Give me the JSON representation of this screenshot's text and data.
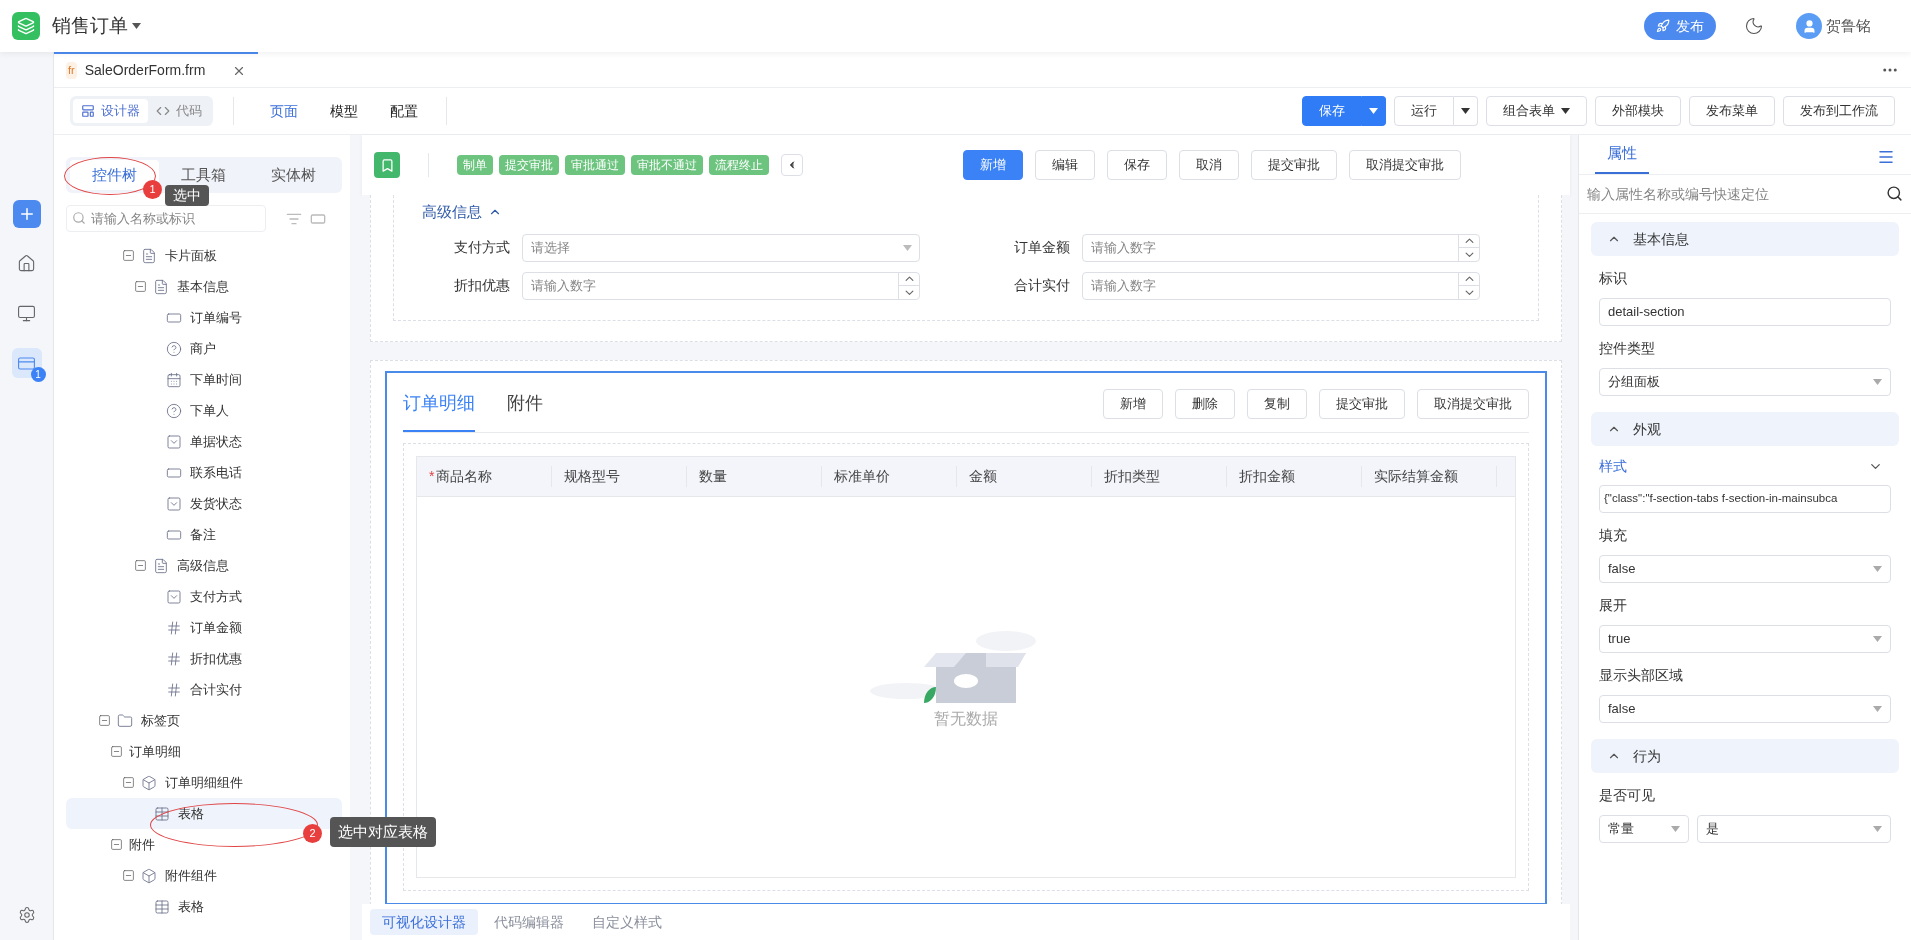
{
  "app_bar": {
    "title": "销售订单",
    "publish_button": "发布",
    "user": "贺鲁铭"
  },
  "file_tab": {
    "badge": "fr",
    "name": "SaleOrderForm.frm"
  },
  "view_switch": [
    {
      "label": "设计器",
      "selected": true,
      "kind": "designer"
    },
    {
      "label": "代码",
      "selected": false,
      "kind": "code"
    }
  ],
  "page_tabs": [
    {
      "label": "页面",
      "selected": true
    },
    {
      "label": "模型",
      "selected": false
    },
    {
      "label": "配置",
      "selected": false
    }
  ],
  "toolbar_buttons": [
    {
      "label": "保存",
      "kind": "primary-split"
    },
    {
      "label": "运行",
      "kind": "split"
    },
    {
      "label": "组合表单",
      "kind": "dropdown"
    },
    {
      "label": "外部模块",
      "kind": "plain"
    },
    {
      "label": "发布菜单",
      "kind": "plain"
    },
    {
      "label": "发布到工作流",
      "kind": "plain"
    }
  ],
  "rail": [
    {
      "kind": "add",
      "selected": false
    },
    {
      "kind": "home",
      "selected": false
    },
    {
      "kind": "monitor",
      "selected": false
    },
    {
      "kind": "forms",
      "selected": true,
      "badge": "1"
    }
  ],
  "left_panel": {
    "tabs": [
      {
        "label": "控件树",
        "selected": true
      },
      {
        "label": "工具箱",
        "selected": false
      },
      {
        "label": "实体树",
        "selected": false
      }
    ],
    "search_placeholder": "请输入名称或标识",
    "tree": [
      {
        "children": [
          {
            "children": [
              {
                "label": "卡片面板",
                "kind": "card",
                "selected": false,
                "expanded": true,
                "children": [
                  {
                    "label": "基本信息",
                    "kind": "card",
                    "selected": false,
                    "expanded": true,
                    "children": [
                      {
                        "label": "订单编号",
                        "kind": "input",
                        "selected": false
                      },
                      {
                        "label": "商户",
                        "kind": "help",
                        "selected": false
                      },
                      {
                        "label": "下单时间",
                        "kind": "date",
                        "selected": false
                      },
                      {
                        "label": "下单人",
                        "kind": "help",
                        "selected": false
                      },
                      {
                        "label": "单据状态",
                        "kind": "select",
                        "selected": false
                      },
                      {
                        "label": "联系电话",
                        "kind": "input",
                        "selected": false
                      },
                      {
                        "label": "发货状态",
                        "kind": "select",
                        "selected": false
                      },
                      {
                        "label": "备注",
                        "kind": "input",
                        "selected": false
                      }
                    ]
                  },
                  {
                    "label": "高级信息",
                    "kind": "card",
                    "selected": false,
                    "expanded": true,
                    "children": [
                      {
                        "label": "支付方式",
                        "kind": "select",
                        "selected": false
                      },
                      {
                        "label": "订单金额",
                        "kind": "number",
                        "selected": false
                      },
                      {
                        "label": "折扣优惠",
                        "kind": "number",
                        "selected": false
                      },
                      {
                        "label": "合计实付",
                        "kind": "number",
                        "selected": false
                      }
                    ]
                  }
                ]
              }
            ]
          }
        ]
      },
      {
        "label": "标签页",
        "kind": "tabs",
        "selected": false,
        "expanded": true,
        "children": [
          {
            "label": "订单明细",
            "selected": false,
            "expanded": true,
            "children": [
              {
                "label": "订单明细组件",
                "kind": "component",
                "selected": false,
                "expanded": true,
                "children": [
                  {
                    "label": "表格",
                    "kind": "table",
                    "selected": true
                  }
                ]
              }
            ]
          },
          {
            "label": "附件",
            "selected": false,
            "expanded": true,
            "children": [
              {
                "label": "附件组件",
                "kind": "component",
                "selected": false,
                "expanded": true,
                "children": [
                  {
                    "label": "表格",
                    "kind": "table",
                    "selected": false
                  }
                ]
              }
            ]
          }
        ]
      }
    ]
  },
  "form_toolbar": {
    "states": [
      "制单",
      "提交审批",
      "审批通过",
      "审批不通过",
      "流程终止"
    ],
    "buttons": [
      {
        "label": "新增",
        "primary": true
      },
      {
        "label": "编辑",
        "primary": false
      },
      {
        "label": "保存",
        "primary": false
      },
      {
        "label": "取消",
        "primary": false
      },
      {
        "label": "提交审批",
        "primary": false
      },
      {
        "label": "取消提交审批",
        "primary": false
      }
    ]
  },
  "section": {
    "title": "高级信息",
    "expanded": true,
    "fields": [
      {
        "label": "支付方式",
        "kind": "select",
        "placeholder": "请选择"
      },
      {
        "label": "订单金额",
        "kind": "number",
        "placeholder": "请输入数字"
      },
      {
        "label": "折扣优惠",
        "kind": "number",
        "placeholder": "请输入数字"
      },
      {
        "label": "合计实付",
        "kind": "number",
        "placeholder": "请输入数字"
      }
    ]
  },
  "detail_tabs": {
    "tabs": [
      {
        "label": "订单明细",
        "selected": true
      },
      {
        "label": "附件",
        "selected": false
      }
    ],
    "buttons": [
      "新增",
      "删除",
      "复制",
      "提交审批",
      "取消提交审批"
    ],
    "required_symbol": "*",
    "columns": [
      {
        "label": "商品名称",
        "required": true
      },
      {
        "label": "规格型号",
        "required": false
      },
      {
        "label": "数量",
        "required": false
      },
      {
        "label": "标准单价",
        "required": false
      },
      {
        "label": "金额",
        "required": false
      },
      {
        "label": "折扣类型",
        "required": false
      },
      {
        "label": "折扣金额",
        "required": false
      },
      {
        "label": "实际结算金额",
        "required": false
      }
    ],
    "empty_text": "暂无数据"
  },
  "bottom_tabs": [
    {
      "label": "可视化设计器",
      "selected": true
    },
    {
      "label": "代码编辑器",
      "selected": false
    },
    {
      "label": "自定义样式",
      "selected": false
    }
  ],
  "properties": {
    "tab": "属性",
    "search_placeholder": "输入属性名称或编号快速定位",
    "groups": [
      {
        "title": "基本信息",
        "expanded": true,
        "items": [
          {
            "label": "标识",
            "kind": "text",
            "value": "detail-section"
          },
          {
            "label": "控件类型",
            "kind": "select",
            "value": "分组面板"
          }
        ]
      },
      {
        "title": "外观",
        "expanded": true,
        "items": [
          {
            "label": "样式",
            "kind": "style",
            "value": "{\"class\":\"f-section-tabs f-section-in-mainsubca"
          },
          {
            "label": "填充",
            "kind": "select",
            "value": "false"
          },
          {
            "label": "展开",
            "kind": "select",
            "value": "true"
          },
          {
            "label": "显示头部区域",
            "kind": "select",
            "value": "false"
          }
        ]
      },
      {
        "title": "行为",
        "expanded": true,
        "items": [
          {
            "label": "是否可见",
            "kind": "pair",
            "values": [
              "常量",
              "是"
            ]
          }
        ]
      }
    ]
  },
  "annotations": [
    {
      "number": "1",
      "text": "选中"
    },
    {
      "number": "2",
      "text": "选中对应表格"
    }
  ]
}
